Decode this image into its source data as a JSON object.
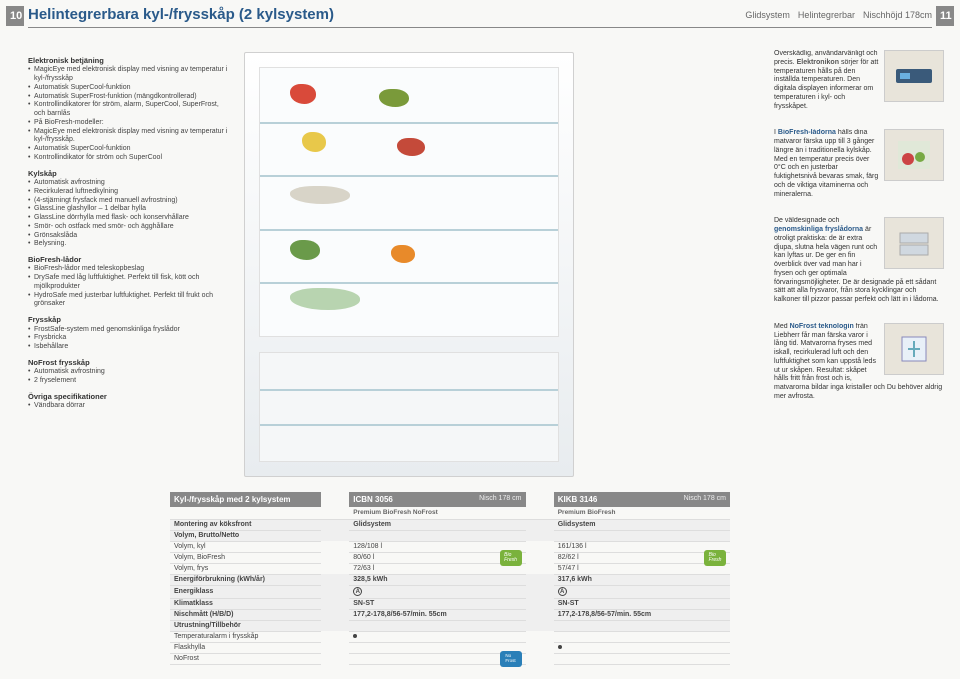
{
  "page_left": "10",
  "page_right": "11",
  "header": {
    "title": "Helintegrerbara kyl-/frysskåp (2 kylsystem)",
    "tags": [
      "Glidsystem",
      "Helintegrerbar",
      "Nischhöjd 178cm"
    ]
  },
  "left": {
    "s1_title": "Elektronisk betjäning",
    "s1_items": [
      "MagicEye med elektronisk display med visning av temperatur i kyl-/frysskåp",
      "Automatisk SuperCool-funktion",
      "Automatisk SuperFrost-funktion (mängdkontrollerad)",
      "Kontrollindikatorer för ström, alarm, SuperCool, SuperFrost, och barnlås",
      "På BioFresh-modeller:",
      "MagicEye med elektronisk display med visning av temperatur i kyl-/frysskåp.",
      "Automatisk SuperCool-funktion",
      "Kontrollindikator för ström och SuperCool"
    ],
    "s2_title": "Kylskåp",
    "s2_items": [
      "Automatisk avfrostning",
      "Recirkulerad luftnedkylning",
      "(4-stjärningt frysfack med manuell avfrostning)",
      "GlassLine glashyllor – 1 delbar hylla",
      "GlassLine dörrhylla med flask- och konservhållare",
      "Smör- och ostfack med smör- och ägghållare",
      "Grönsakslåda",
      "Belysning."
    ],
    "s3_title": "BioFresh-lådor",
    "s3_items": [
      "BioFresh-lådor med teleskopbeslag",
      "DrySafe med låg luftfuktighet. Perfekt till fisk, kött och mjölkprodukter",
      "HydroSafe med justerbar luftfuktighet. Perfekt till frukt och grönsaker"
    ],
    "s4_title": "Frysskåp",
    "s4_items": [
      "FrostSafe-system med genomskinliga fryslådor",
      "Frysbricka",
      "Isbehållare"
    ],
    "s5_title": "NoFrost frysskåp",
    "s5_items": [
      "Automatisk avfrostning",
      "2 fryselement"
    ],
    "s6_title": "Övriga specifikationer",
    "s6_items": [
      "Vändbara dörrar"
    ]
  },
  "right": {
    "p1_kw": "Elektronikon",
    "p1": "Överskådlig, användarvänligt och precis. sörjer för att temperaturen hålls på den inställda temperaturen. Den digitala displayen informerar om temperaturen i kyl- och frysskåpet.",
    "p2_kw": "BioFresh-lådorna",
    "p2": "I hålls dina matvaror färska upp till 3 gånger längre än i traditionella kylskåp. Med en temperatur precis över 0°C och en justerbar fuktighetsnivå bevaras smak, färg och de viktiga vitaminerna och mineralerna.",
    "p3_kw": "genomskinliga fryslådorna",
    "p3": "De väldesignade och är otroligt praktiska: de är extra djupa, slutna hela vägen runt och kan lyftas ur. De ger en fin överblick över vad man har i frysen och ger optimala förvaringsmöjligheter. De är designade på ett sådant sätt att alla frysvaror, från stora kycklingar och kalkoner till pizzor passar perfekt och lätt in i lådorna.",
    "p4_kw": "NoFrost teknologin",
    "p4": "Med från Liebherr får man färska varor i lång tid. Matvarorna fryses med iskall, recirkulerad luft och den luftfuktighet som kan uppstå leds ut ur skåpen. Resultat: skåpet hålls fritt från frost och is, matvarorna bildar inga kristaller och Du behöver aldrig mer avfrosta."
  },
  "table": {
    "col0_group": "Kyl-/frysskåp med 2 kylsystem",
    "col1_name": "ICBN 3056",
    "col1_sub": "Premium BioFresh NoFrost",
    "col1_nisch": "Nisch 178 cm",
    "col2_name": "KIKB 3146",
    "col2_sub": "Premium BioFresh",
    "col2_nisch": "Nisch 178 cm",
    "rows": [
      {
        "label": "Montering av köksfront",
        "c1": "Glidsystem",
        "c2": "Glidsystem",
        "section": true
      },
      {
        "label": "Volym, Brutto/Netto",
        "c1": "",
        "c2": "",
        "section": true
      },
      {
        "label": "Volym, kyl",
        "c1": "128/108 l",
        "c2": "161/136 l"
      },
      {
        "label": "Volym, BioFresh",
        "c1": "80/60 l",
        "c2": "82/62 l",
        "bio": true
      },
      {
        "label": "Volym, frys",
        "c1": "72/63 l",
        "c2": "57/47 l"
      },
      {
        "label": "Energiförbrukning (kWh/år)",
        "c1": "328,5 kWh",
        "c2": "317,6 kWh",
        "section": true
      },
      {
        "label": "Energiklass",
        "c1": "A",
        "c2": "A",
        "section": true,
        "a": true
      },
      {
        "label": "Klimatklass",
        "c1": "SN-ST",
        "c2": "SN-ST",
        "section": true
      },
      {
        "label": "Nischmått (H/B/D)",
        "c1": "177,2-178,8/56-57/min. 55cm",
        "c2": "177,2-178,8/56-57/min. 55cm",
        "section": true
      },
      {
        "label": "Utrustning/Tillbehör",
        "c1": "",
        "c2": "",
        "section": true
      },
      {
        "label": "Temperaturalarm i frysskåp",
        "c1": "•",
        "c2": "",
        "dot": true
      },
      {
        "label": "Flaskhylla",
        "c1": "",
        "c2": "•",
        "dot": true
      },
      {
        "label": "NoFrost",
        "c1": "nf",
        "c2": "",
        "nofrost": true
      }
    ]
  }
}
